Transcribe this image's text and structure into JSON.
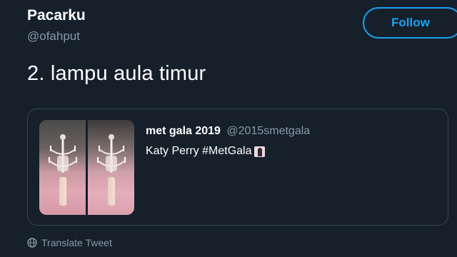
{
  "user": {
    "display_name": "Pacarku",
    "handle": "@ofahput"
  },
  "follow_button": {
    "label": "Follow"
  },
  "tweet": {
    "text": "2. lampu aula timur"
  },
  "quoted_tweet": {
    "display_name": "met gala 2019",
    "handle": "@2015smetgala",
    "text": "Katy Perry #MetGala",
    "emoji_icon": "woman-emoji-icon",
    "photos": [
      "photo-left",
      "photo-right"
    ]
  },
  "footer": {
    "translate_label": "Translate Tweet",
    "translate_icon": "globe-icon"
  },
  "colors": {
    "background": "#15202b",
    "accent": "#1da1f2",
    "secondary_text": "#8899a6",
    "border": "#38444d"
  }
}
